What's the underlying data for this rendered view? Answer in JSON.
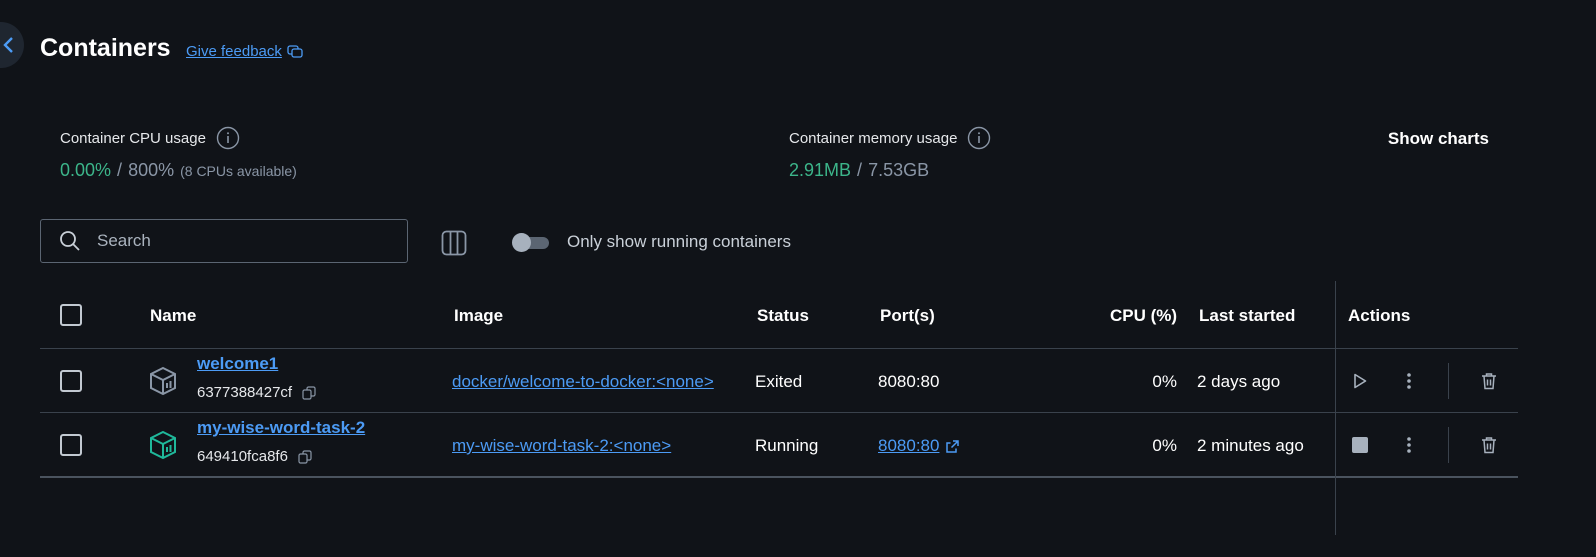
{
  "header": {
    "title": "Containers",
    "feedback_label": "Give feedback"
  },
  "stats": {
    "cpu": {
      "label": "Container CPU usage",
      "used": "0.00%",
      "sep": "/",
      "total": "800%",
      "note": "(8 CPUs available)"
    },
    "memory": {
      "label": "Container memory usage",
      "used": "2.91MB",
      "sep": "/",
      "total": "7.53GB"
    },
    "show_charts_label": "Show charts"
  },
  "toolbar": {
    "search_placeholder": "Search",
    "toggle_label": "Only show running containers",
    "toggle_on": false
  },
  "table": {
    "headers": {
      "name": "Name",
      "image": "Image",
      "status": "Status",
      "ports": "Port(s)",
      "cpu": "CPU (%)",
      "last_started": "Last started",
      "actions": "Actions"
    },
    "rows": [
      {
        "name": "welcome1",
        "id": "6377388427cf",
        "image": "docker/welcome-to-docker:<none>",
        "status": "Exited",
        "ports": "8080:80",
        "cpu": "0%",
        "last_started": "2 days ago",
        "running": false
      },
      {
        "name": "my-wise-word-task-2",
        "id": "649410fca8f6",
        "image": "my-wise-word-task-2:<none>",
        "status": "Running",
        "ports": "8080:80",
        "cpu": "0%",
        "last_started": "2 minutes ago",
        "running": true
      }
    ]
  },
  "colors": {
    "background": "#101318",
    "accent_link": "#4c9bf5",
    "usage_green": "#3cb58a",
    "running_icon": "#1fb89a",
    "exited_icon": "#8a96a6"
  }
}
